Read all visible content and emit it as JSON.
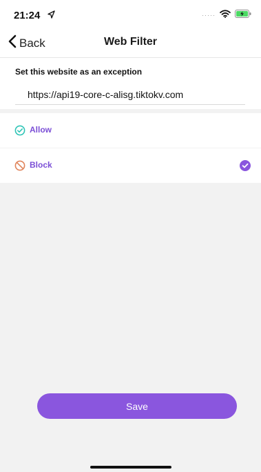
{
  "status_bar": {
    "time": "21:24",
    "icons": [
      "location-arrow-icon",
      "signal-dots-icon",
      "wifi-icon",
      "battery-charging-icon"
    ]
  },
  "nav": {
    "back_label": "Back",
    "title": "Web Filter",
    "back_icon": "chevron-left-icon"
  },
  "exception": {
    "heading": "Set this website as an exception",
    "url": "https://api19-core-c-alisg.tiktokv.com"
  },
  "options": [
    {
      "label": "Allow",
      "icon": "check-circle-icon",
      "selected": false,
      "color": "#2ec4b6"
    },
    {
      "label": "Block",
      "icon": "block-icon",
      "selected": true,
      "color": "#e0835a"
    }
  ],
  "save_label": "Save",
  "colors": {
    "accent": "#8a56de",
    "option_label": "#7b4fd6",
    "allow": "#2ec4b6",
    "block": "#e0835a",
    "background": "#f2f2f2"
  }
}
